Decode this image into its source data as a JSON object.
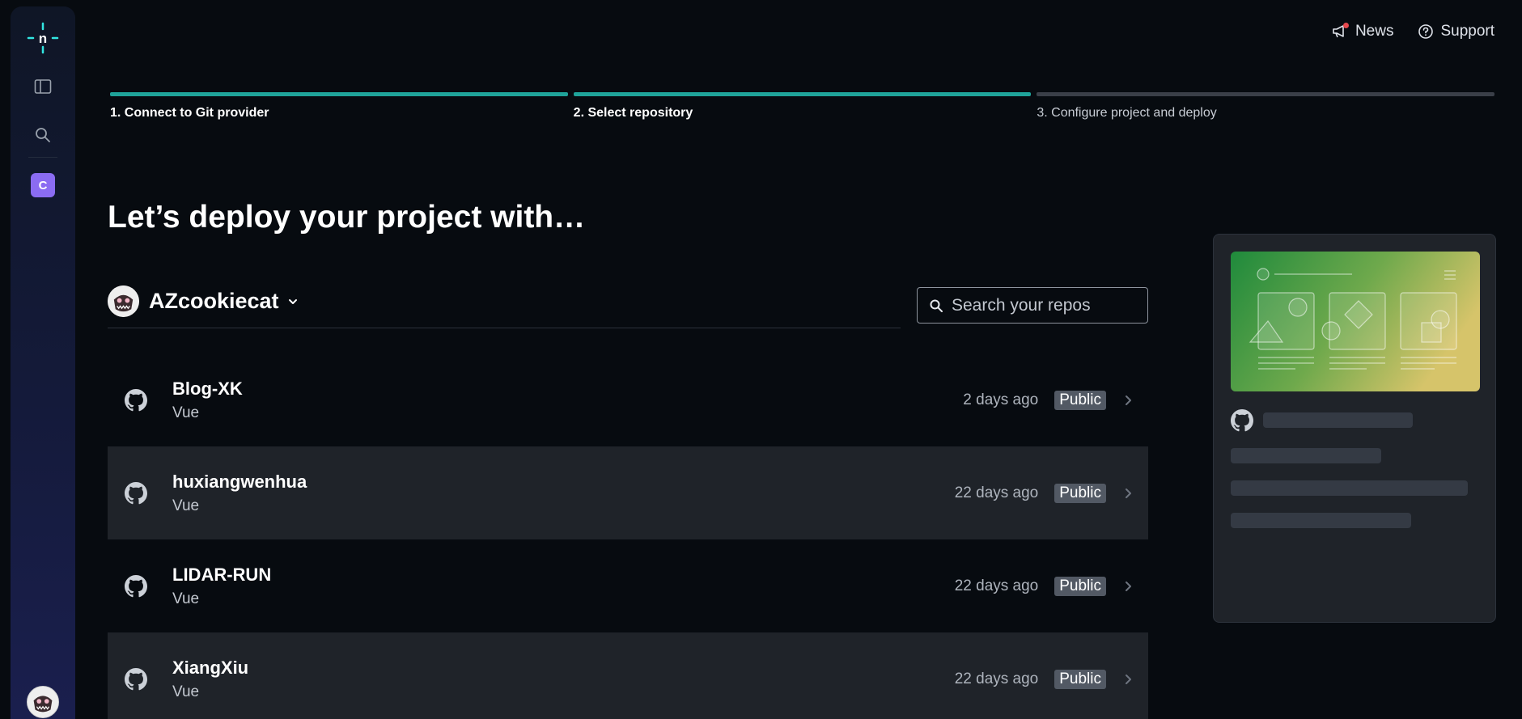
{
  "topnav": {
    "news_label": "News",
    "support_label": "Support"
  },
  "sidebar": {
    "team_initial": "C"
  },
  "stepper": {
    "steps": [
      {
        "label": "1. Connect to Git provider",
        "active": true
      },
      {
        "label": "2. Select repository",
        "active": true
      },
      {
        "label": "3. Configure project and deploy",
        "active": false
      }
    ]
  },
  "main": {
    "heading": "Let’s deploy your project with…",
    "account_name": "AZcookiecat",
    "search_placeholder": "Search your repos"
  },
  "repos": [
    {
      "name": "Blog-XK",
      "language": "Vue",
      "updated": "2 days ago",
      "visibility": "Public"
    },
    {
      "name": "huxiangwenhua",
      "language": "Vue",
      "updated": "22 days ago",
      "visibility": "Public"
    },
    {
      "name": "LIDAR-RUN",
      "language": "Vue",
      "updated": "22 days ago",
      "visibility": "Public"
    },
    {
      "name": "XiangXiu",
      "language": "Vue",
      "updated": "22 days ago",
      "visibility": "Public"
    }
  ],
  "colors": {
    "accent": "#1fa39a",
    "background": "#070b10",
    "row_alt": "#1f2329",
    "team_badge": "#8b6cf2",
    "news_dot": "#e5484d"
  },
  "icons": {
    "logo": "netlify-logo-icon",
    "panel": "sidebar-panel-icon",
    "search": "search-icon",
    "news": "megaphone-icon",
    "support": "help-circle-icon",
    "repo": "github-icon",
    "chevron": "chevron-right-icon"
  }
}
